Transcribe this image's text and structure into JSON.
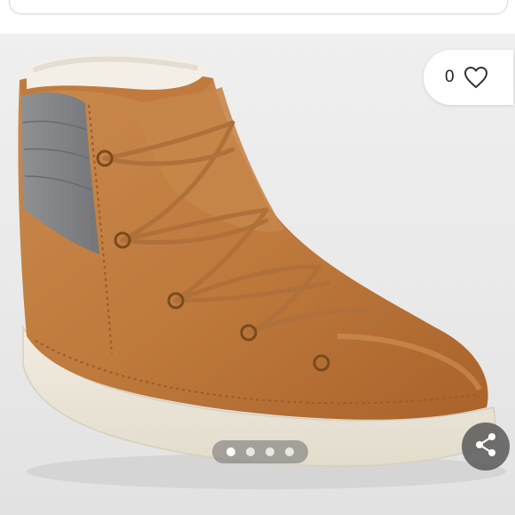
{
  "listing": {
    "like_count": "0",
    "photo_count": 4,
    "active_photo_index": 0
  },
  "icons": {
    "like": "heart-outline-icon",
    "share": "share-icon"
  },
  "colors": {
    "accent_dot": "#ffffff",
    "share_button": "#505050"
  }
}
